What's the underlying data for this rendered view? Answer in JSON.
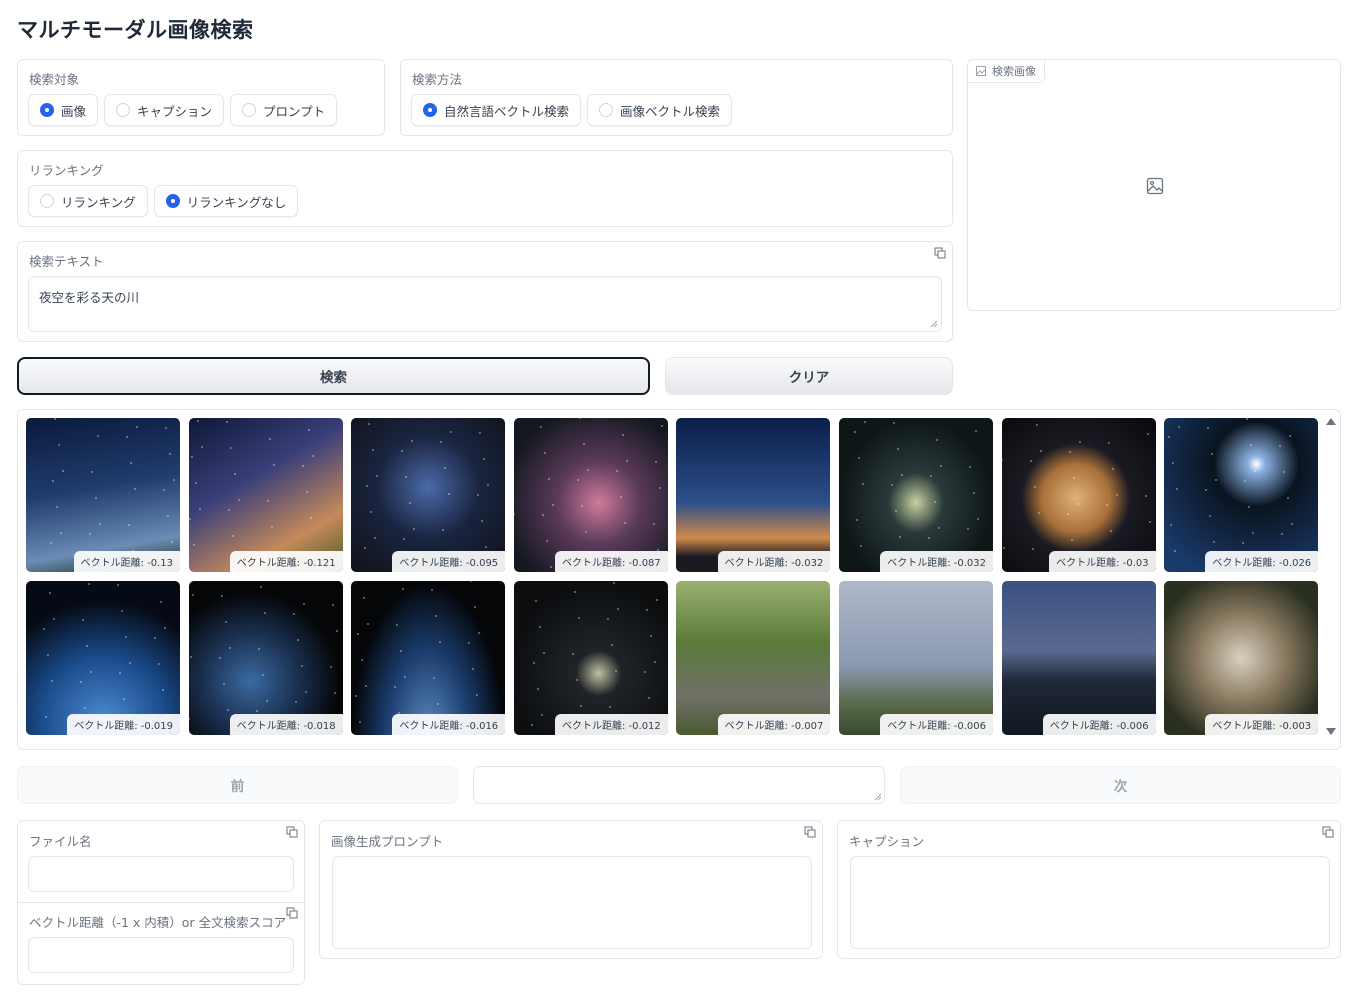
{
  "app": {
    "title": "マルチモーダル画像検索"
  },
  "search_target": {
    "label": "検索対象",
    "options": [
      {
        "label": "画像",
        "selected": true
      },
      {
        "label": "キャプション",
        "selected": false
      },
      {
        "label": "プロンプト",
        "selected": false
      }
    ]
  },
  "search_method": {
    "label": "検索方法",
    "options": [
      {
        "label": "自然言語ベクトル検索",
        "selected": true
      },
      {
        "label": "画像ベクトル検索",
        "selected": false
      }
    ]
  },
  "reranking": {
    "label": "リランキング",
    "options": [
      {
        "label": "リランキング",
        "selected": false
      },
      {
        "label": "リランキングなし",
        "selected": true
      }
    ]
  },
  "search_text": {
    "label": "検索テキスト",
    "value": "夜空を彩る天の川"
  },
  "search_image": {
    "label": "検索画像"
  },
  "buttons": {
    "search": "検索",
    "clear": "クリア",
    "prev": "前",
    "next": "次"
  },
  "pager": {
    "value": ""
  },
  "gallery": {
    "items": [
      {
        "caption": "ベクトル距離: -0.13",
        "bg": "linear-gradient(170deg,#0b1a3a 0%,#1f3c6e 45%,#6b8cb5 80%,#1b2a1a 100%)",
        "icon": "milky-way-image"
      },
      {
        "caption": "ベクトル距離: -0.121",
        "bg": "linear-gradient(150deg,#0f1838 0%,#3b3f7a 40%,#c58a5a 75%,#4a5a2a 100%)",
        "icon": "milky-way-image"
      },
      {
        "caption": "ベクトル距離: -0.095",
        "bg": "radial-gradient(circle at 50% 45%,#4a6aa8 0%,#1a2440 45%,#101216 100%)",
        "icon": "pleiades-image"
      },
      {
        "caption": "ベクトル距離: -0.087",
        "bg": "radial-gradient(circle at 55% 55%,#d07a9a 0%,#5a3a5a 35%,#141820 80%)",
        "icon": "orion-nebula-image"
      },
      {
        "caption": "ベクトル距離: -0.032",
        "bg": "linear-gradient(180deg,#0b1e4a 0%,#2d4f8a 55%,#d08a4a 78%,#1a1a22 90%)",
        "icon": "twilight-city-image"
      },
      {
        "caption": "ベクトル距離: -0.032",
        "bg": "radial-gradient(ellipse at 50% 55%,#c8d0a0 0%,#2a3a3a 25%,#0e1618 70%)",
        "icon": "edge-on-galaxy-image"
      },
      {
        "caption": "ベクトル距離: -0.03",
        "bg": "radial-gradient(circle at 48% 52%,#e0b07a 0%,#a8703a 30%,#1a1a22 48%,#08080c 100%)",
        "icon": "jupiter-image"
      },
      {
        "caption": "ベクトル距離: -0.026",
        "bg": "radial-gradient(circle at 60% 30%,#ffffff 0%,#8ab0e0 6%,#0a1420 30%,#1a3a6a 85%)",
        "icon": "earth-horizon-image"
      },
      {
        "caption": "ベクトル距離: -0.019",
        "bg": "radial-gradient(circle at 50% 90%,#4a8ad0 0%,#1a4a8a 40%,#050a14 75%)",
        "icon": "earth-image"
      },
      {
        "caption": "ベクトル距離: -0.018",
        "bg": "radial-gradient(circle at 40% 65%,#3a6aa0 0%,#1a3050 35%,#050608 65%)",
        "icon": "earth-image"
      },
      {
        "caption": "ベクトル距離: -0.016",
        "bg": "radial-gradient(ellipse at 50% 100%,#5a8ac0 0%,#1a3a6a 40%,#040608 70%)",
        "icon": "earth-horizon-image"
      },
      {
        "caption": "ベクトル距離: -0.012",
        "bg": "radial-gradient(circle at 55% 60%,#c0c0a0 0%,#202428 18%,#0c0e10 70%)",
        "icon": "galaxy-field-image"
      },
      {
        "caption": "ベクトル距離: -0.007",
        "bg": "linear-gradient(180deg,#9ab070 0%,#5a7a3a 40%,#707068 75%,#4a5a30 100%)",
        "icon": "cat-image"
      },
      {
        "caption": "ベクトル距離: -0.006",
        "bg": "linear-gradient(180deg,#b0b8c8 0%,#8a98b0 55%,#5a6a4a 80%,#3a4a30 100%)",
        "icon": "rainbow-image"
      },
      {
        "caption": "ベクトル距離: -0.006",
        "bg": "linear-gradient(180deg,#3a5080 0%,#5a6a90 45%,#202838 65%,#101820 100%)",
        "icon": "night-river-image"
      },
      {
        "caption": "ベクトル距離: -0.003",
        "bg": "radial-gradient(circle at 50% 50%,#d8d0c0 0%,#8a7a60 40%,#2a3020 80%)",
        "icon": "cat-image"
      }
    ]
  },
  "filename": {
    "label": "ファイル名",
    "value": ""
  },
  "distance": {
    "label": "ベクトル距離（-1 x 内積）or 全文検索スコア",
    "value": ""
  },
  "prompt": {
    "label": "画像生成プロンプト",
    "value": ""
  },
  "caption": {
    "label": "キャプション",
    "value": ""
  },
  "colors": {
    "accent": "#2563eb",
    "border": "#e5e7eb",
    "label": "#6b7280"
  }
}
